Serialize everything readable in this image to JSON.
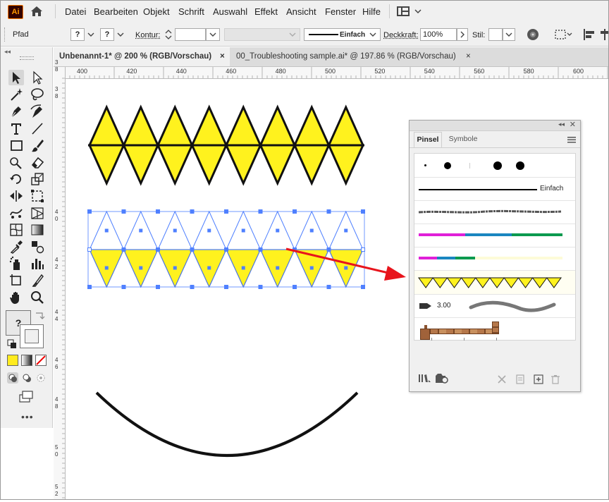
{
  "app": {
    "logo": "Ai"
  },
  "menu": [
    "Datei",
    "Bearbeiten",
    "Objekt",
    "Schrift",
    "Auswahl",
    "Effekt",
    "Ansicht",
    "Fenster",
    "Hilfe"
  ],
  "control_bar": {
    "selection_label": "Pfad",
    "fill_value": "?",
    "stroke_value": "?",
    "contour_label": "Kontur:",
    "stroke_style_label": "Einfach",
    "opacity_label": "Deckkraft:",
    "opacity_value": "100%",
    "style_label": "Stil:"
  },
  "tabs": [
    {
      "label": "Unbenannt-1* @ 200 % (RGB/Vorschau)",
      "active": true
    },
    {
      "label": "00_Troubleshooting sample.ai* @ 197.86 % (RGB/Vorschau)",
      "active": false
    }
  ],
  "tab_close_glyph": "×",
  "ruler_h": [
    "400",
    "420",
    "440",
    "460",
    "480",
    "500",
    "520",
    "540",
    "560",
    "580",
    "600"
  ],
  "ruler_v": [
    "3",
    "8",
    "3",
    "8",
    "4",
    "0",
    "4",
    "2",
    "4",
    "4",
    "4",
    "6",
    "4",
    "8",
    "5",
    "0",
    "5",
    "2"
  ],
  "toolbar": {
    "more": "•••",
    "fill_unknown": "?"
  },
  "brush_panel": {
    "tabs": [
      "Pinsel",
      "Symbole"
    ],
    "basic_brush_label": "Einfach",
    "arrow_brush_size": "3.00"
  },
  "colors": {
    "accent_yellow": "#fff21e",
    "selection_blue": "#4f80ff",
    "arrow_red": "#e8141c",
    "panel_bg": "#f0f0f0",
    "magenta": "#e020d8",
    "teal": "#1a86c0",
    "green": "#0c9a4f"
  }
}
